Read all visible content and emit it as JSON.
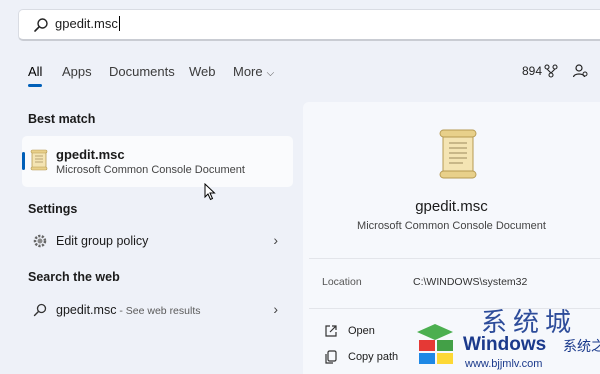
{
  "search": {
    "query": "gpedit.msc"
  },
  "tabs": [
    {
      "label": "All",
      "active": true
    },
    {
      "label": "Apps"
    },
    {
      "label": "Documents"
    },
    {
      "label": "Web"
    },
    {
      "label": "More"
    }
  ],
  "header": {
    "points": "894"
  },
  "best_match": {
    "heading": "Best match",
    "title": "gpedit.msc",
    "subtitle": "Microsoft Common Console Document"
  },
  "settings": {
    "heading": "Settings",
    "item": "Edit group policy"
  },
  "web": {
    "heading": "Search the web",
    "query": "gpedit.msc",
    "hint": " - See web results"
  },
  "preview": {
    "title": "gpedit.msc",
    "subtitle": "Microsoft Common Console Document",
    "location_label": "Location",
    "location_value": "C:\\WINDOWS\\system32",
    "actions": [
      "Open",
      "Copy path"
    ]
  },
  "watermark": {
    "brand": "Windows",
    "brand_cn": "系统之家",
    "url": "www.bjjmlv.com",
    "big_cn": "系统城"
  },
  "colors": {
    "accent": "#005fb8",
    "background": "#eef1f8"
  }
}
